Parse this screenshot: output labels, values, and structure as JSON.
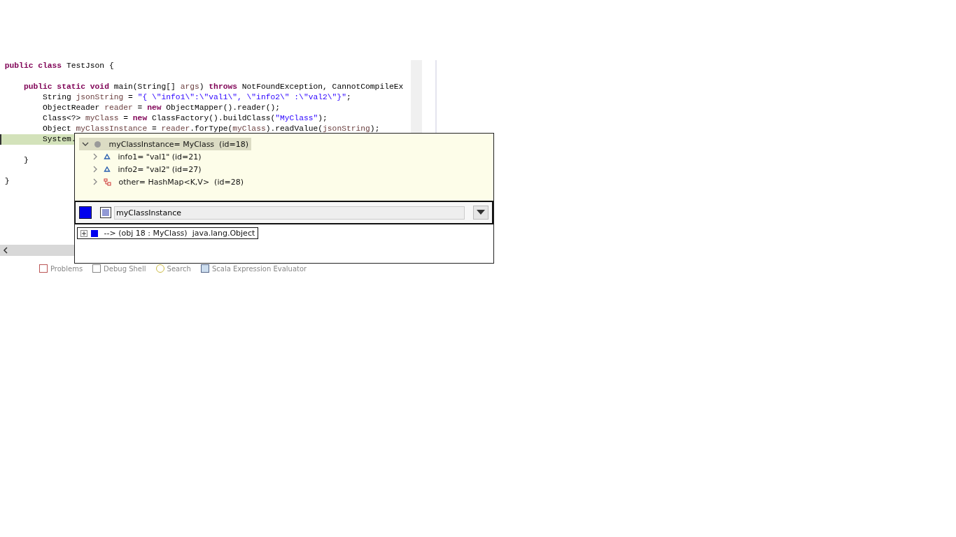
{
  "editor": {
    "lines": [
      {
        "current": false,
        "tokens": [
          {
            "kind": "kw",
            "text": "public class"
          },
          {
            "kind": "plain",
            "text": " TestJson {"
          }
        ]
      },
      {
        "current": false
      },
      {
        "current": false,
        "tokens": [
          {
            "kind": "kw",
            "text": "    public static void"
          },
          {
            "kind": "plain",
            "text": " main(String[] "
          },
          {
            "kind": "var",
            "text": "args"
          },
          {
            "kind": "plain",
            "text": ") "
          },
          {
            "kind": "kw",
            "text": "throws"
          },
          {
            "kind": "plain",
            "text": " NotFoundException, CannotCompileEx"
          }
        ]
      },
      {
        "current": false,
        "tokens": [
          {
            "kind": "plain",
            "text": "        String "
          },
          {
            "kind": "var",
            "text": "jsonString"
          },
          {
            "kind": "plain",
            "text": " = "
          },
          {
            "kind": "str",
            "text": "\"{ \\\"info1\\\":\\\"val1\\\", \\\"info2\\\" :\\\"val2\\\"}\""
          },
          {
            "kind": "plain",
            "text": ";"
          }
        ]
      },
      {
        "current": false,
        "tokens": [
          {
            "kind": "plain",
            "text": "        ObjectReader "
          },
          {
            "kind": "var",
            "text": "reader"
          },
          {
            "kind": "plain",
            "text": " = "
          },
          {
            "kind": "kw",
            "text": "new"
          },
          {
            "kind": "plain",
            "text": " ObjectMapper().reader();"
          }
        ]
      },
      {
        "current": false,
        "tokens": [
          {
            "kind": "plain",
            "text": "        Class<?> "
          },
          {
            "kind": "var",
            "text": "myClass"
          },
          {
            "kind": "plain",
            "text": " = "
          },
          {
            "kind": "kw",
            "text": "new"
          },
          {
            "kind": "plain",
            "text": " ClassFactory().buildClass("
          },
          {
            "kind": "str",
            "text": "\"MyClass\""
          },
          {
            "kind": "plain",
            "text": ");"
          }
        ]
      },
      {
        "current": false,
        "tokens": [
          {
            "kind": "plain",
            "text": "        Object "
          },
          {
            "kind": "var",
            "text": "myClassInstance"
          },
          {
            "kind": "plain",
            "text": " = "
          },
          {
            "kind": "var",
            "text": "reader"
          },
          {
            "kind": "plain",
            "text": ".forType("
          },
          {
            "kind": "var",
            "text": "myClass"
          },
          {
            "kind": "plain",
            "text": ").readValue("
          },
          {
            "kind": "var",
            "text": "jsonString"
          },
          {
            "kind": "plain",
            "text": ");"
          }
        ]
      },
      {
        "current": true,
        "tokens": [
          {
            "kind": "plain",
            "text": "        System."
          }
        ]
      },
      {
        "current": false
      },
      {
        "current": false,
        "tokens": [
          {
            "kind": "plain",
            "text": "    }"
          }
        ]
      },
      {
        "current": false
      },
      {
        "current": false,
        "tokens": [
          {
            "kind": "plain",
            "text": "}"
          }
        ]
      }
    ]
  },
  "popup": {
    "variable": {
      "label": "myClassInstance= MyClass  (id=18)",
      "expanded": true,
      "selected": true,
      "children": [
        {
          "kind": "field",
          "label": "info1= \"val1\" (id=21)",
          "expanded": false
        },
        {
          "kind": "field",
          "label": "info2= \"val2\" (id=27)",
          "expanded": false
        },
        {
          "kind": "map",
          "label": "other= HashMap<K,V>  (id=28)",
          "expanded": false
        }
      ]
    },
    "expression": {
      "value": "myClassInstance"
    },
    "result": {
      "label": "--> (obj 18 : MyClass)  java.lang.Object",
      "expanded": false
    }
  },
  "bottom_tabs": [
    {
      "label": "Problems",
      "kind": "problems"
    },
    {
      "label": "Debug Shell",
      "kind": "shell"
    },
    {
      "label": "Search",
      "kind": "search"
    },
    {
      "label": "Scala Expression Evaluator",
      "kind": "scala"
    }
  ]
}
